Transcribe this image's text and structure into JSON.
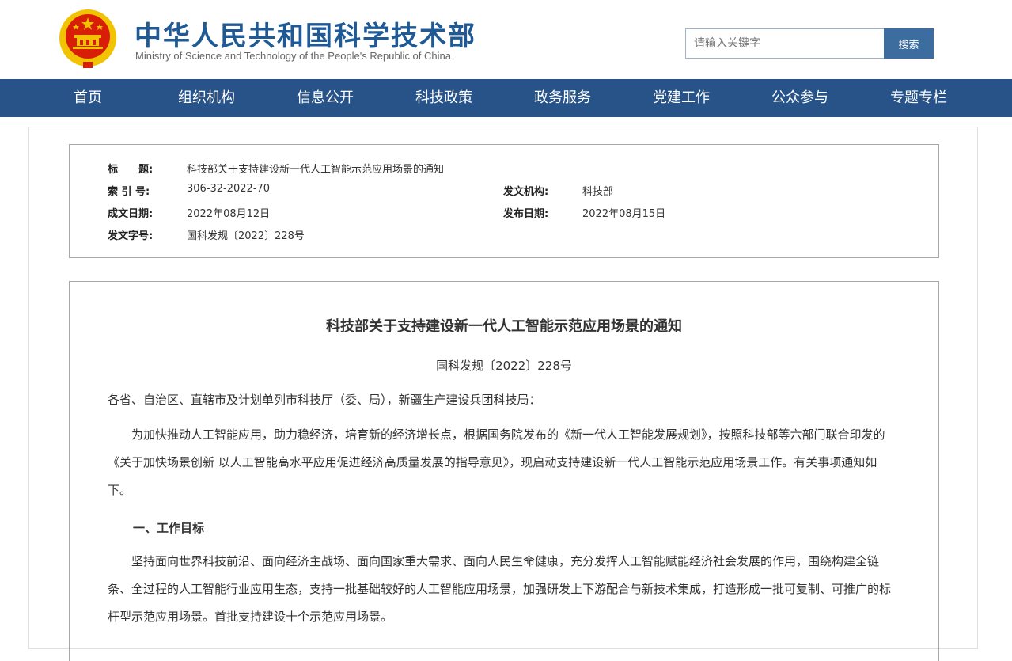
{
  "header": {
    "title": "中华人民共和国科学技术部",
    "subtitle": "Ministry of Science and Technology of the People's Republic of China",
    "emblem_colors": {
      "red": "#d81e06",
      "gold": "#f2c300"
    }
  },
  "search": {
    "placeholder": "请输入关键字",
    "button_label": "搜索"
  },
  "nav": {
    "items": [
      {
        "label": "首页"
      },
      {
        "label": "组织机构"
      },
      {
        "label": "信息公开"
      },
      {
        "label": "科技政策"
      },
      {
        "label": "政务服务"
      },
      {
        "label": "党建工作"
      },
      {
        "label": "公众参与"
      },
      {
        "label": "专题专栏"
      }
    ],
    "bg_color": "#275389"
  },
  "meta": {
    "title_label": "标　　题:",
    "title_value": "科技部关于支持建设新一代人工智能示范应用场景的通知",
    "index_label": "索 引 号:",
    "index_value": "306-32-2022-70",
    "issuer_label": "发文机构:",
    "issuer_value": "科技部",
    "created_label": "成文日期:",
    "created_value": "2022年08月12日",
    "published_label": "发布日期:",
    "published_value": "2022年08月15日",
    "docno_label": "发文字号:",
    "docno_value": "国科发规〔2022〕228号"
  },
  "article": {
    "title": "科技部关于支持建设新一代人工智能示范应用场景的通知",
    "doc_number": "国科发规〔2022〕228号",
    "salutation": "各省、自治区、直辖市及计划单列市科技厅（委、局），新疆生产建设兵团科技局：",
    "intro": "为加快推动人工智能应用，助力稳经济，培育新的经济增长点，根据国务院发布的《新一代人工智能发展规划》，按照科技部等六部门联合印发的《关于加快场景创新 以人工智能高水平应用促进经济高质量发展的指导意见》，现启动支持建设新一代人工智能示范应用场景工作。有关事项通知如下。",
    "section1_heading": "一、工作目标",
    "section1_body": "坚持面向世界科技前沿、面向经济主战场、面向国家重大需求、面向人民生命健康，充分发挥人工智能赋能经济社会发展的作用，围绕构建全链条、全过程的人工智能行业应用生态，支持一批基础较好的人工智能应用场景，加强研发上下游配合与新技术集成，打造形成一批可复制、可推广的标杆型示范应用场景。首批支持建设十个示范应用场景。"
  }
}
